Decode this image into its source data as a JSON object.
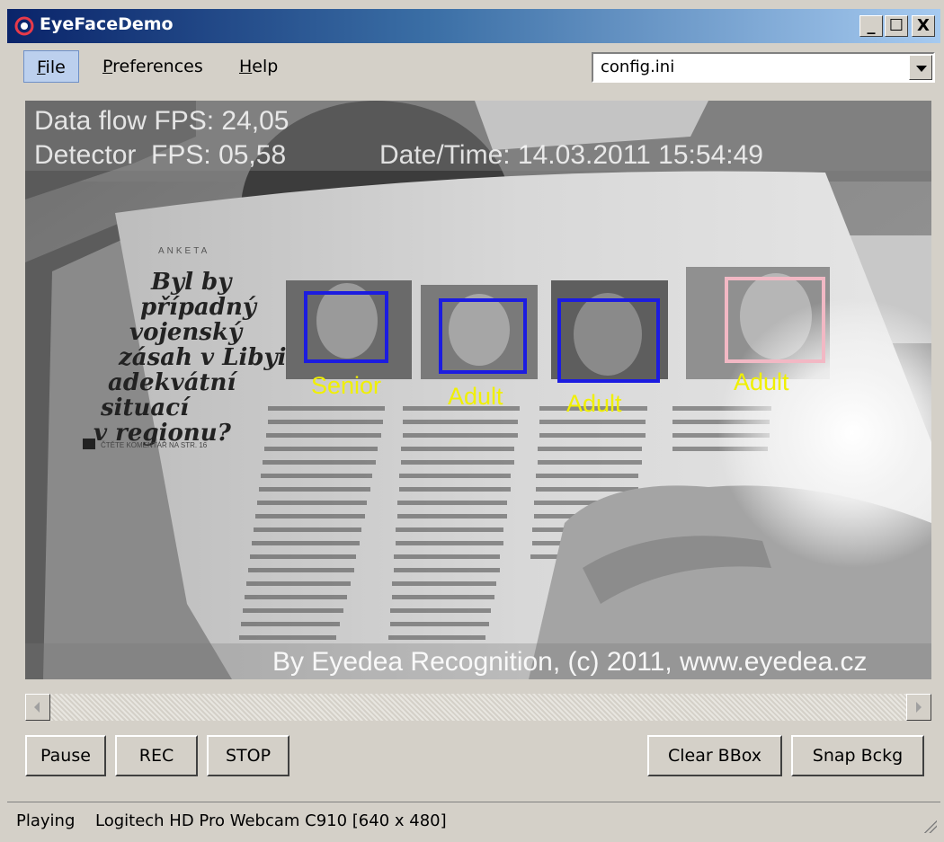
{
  "window": {
    "title": "EyeFaceDemo",
    "controls": [
      "_",
      "☐",
      "X"
    ]
  },
  "menu": {
    "items": [
      {
        "label": "File",
        "underline": "F"
      },
      {
        "label": "Preferences",
        "underline": "P"
      },
      {
        "label": "Help",
        "underline": "H"
      }
    ]
  },
  "config_select": {
    "value": "config.ini"
  },
  "video": {
    "data_flow": "Data flow FPS: 24,05",
    "detector": "Detector  FPS: 05,58",
    "datetime": "Date/Time: 14.03.2011 15:54:49",
    "credit": "By Eyedea Recognition, (c) 2011, www.eyedea.cz",
    "magazine": {
      "section": "ANKETA",
      "headline": [
        "Byl by",
        "případný",
        "vojenský",
        "zásah v Libyi",
        "adekvátní",
        "situací",
        "v regionu?"
      ],
      "sidebar_link": "ČTĚTE KOMENTÁŘ NA STR. 16"
    },
    "faces": [
      {
        "label": "Senior",
        "color": "#1c1ce0"
      },
      {
        "label": "Adult",
        "color": "#1c1ce0"
      },
      {
        "label": "Adult",
        "color": "#1c1ce0"
      },
      {
        "label": "Adult",
        "color": "#f2b8c4"
      }
    ]
  },
  "buttons": {
    "pause": "Pause",
    "rec": "REC",
    "stop": "STOP",
    "clear_bbox": "Clear BBox",
    "snap_bckg": "Snap Bckg"
  },
  "status": {
    "state": "Playing",
    "device": "Logitech HD Pro Webcam C910 [640 x 480]"
  }
}
